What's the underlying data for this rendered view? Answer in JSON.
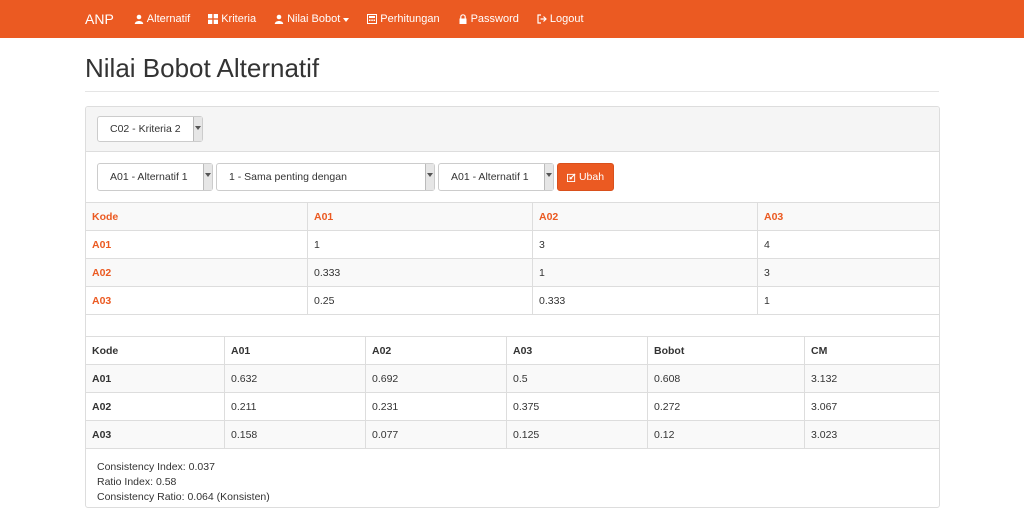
{
  "nav": {
    "brand": "ANP",
    "items": [
      {
        "label": "Alternatif",
        "icon": "user-icon"
      },
      {
        "label": "Kriteria",
        "icon": "grid-icon"
      },
      {
        "label": "Nilai Bobot",
        "icon": "user-icon"
      },
      {
        "label": "Perhitungan",
        "icon": "calculator-icon"
      },
      {
        "label": "Password",
        "icon": "lock-icon"
      },
      {
        "label": "Logout",
        "icon": "logout-icon"
      }
    ]
  },
  "page": {
    "title": "Nilai Bobot Alternatif"
  },
  "filter": {
    "criteria": "C02 - Kriteria 2"
  },
  "form": {
    "alt1": "A01 - Alternatif 1",
    "importance": "1 - Sama penting dengan",
    "alt2": "A01 - Alternatif 1",
    "submit": "Ubah"
  },
  "matrix": {
    "headers": [
      "Kode",
      "A01",
      "A02",
      "A03"
    ],
    "rows": [
      [
        "A01",
        "1",
        "3",
        "4"
      ],
      [
        "A02",
        "0.333",
        "1",
        "3"
      ],
      [
        "A03",
        "0.25",
        "0.333",
        "1"
      ]
    ]
  },
  "normalized": {
    "headers": [
      "Kode",
      "A01",
      "A02",
      "A03",
      "Bobot",
      "CM"
    ],
    "rows": [
      [
        "A01",
        "0.632",
        "0.692",
        "0.5",
        "0.608",
        "3.132"
      ],
      [
        "A02",
        "0.211",
        "0.231",
        "0.375",
        "0.272",
        "3.067"
      ],
      [
        "A03",
        "0.158",
        "0.077",
        "0.125",
        "0.12",
        "3.023"
      ]
    ]
  },
  "results": {
    "ci": "Consistency Index: 0.037",
    "ri": "Ratio Index: 0.58",
    "cr": "Consistency Ratio: 0.064 (Konsisten)"
  }
}
